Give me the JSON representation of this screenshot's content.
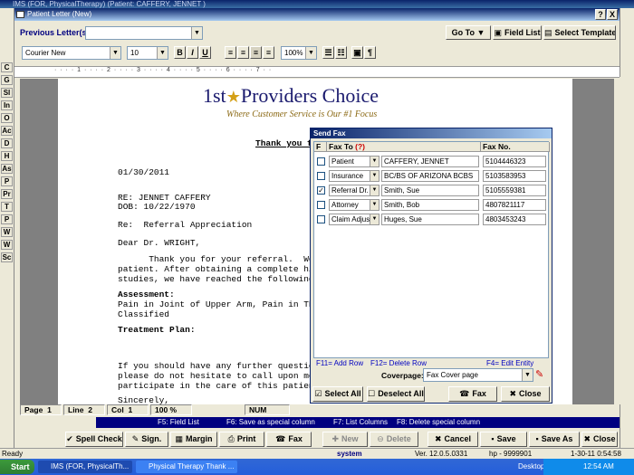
{
  "app": {
    "title": "IMS (FOR, PhysicalTherapy)    (Patient: CAFFERY, JENNET )"
  },
  "window": {
    "title": "Patient Letter (New)",
    "help_btn": "?",
    "close_btn": "X"
  },
  "toolbar": {
    "previous_letters_label": "Previous Letter(s):",
    "previous_letters_value": "",
    "goto": "Go To",
    "field_list": "Field List",
    "select_template": "Select Template"
  },
  "format": {
    "font": "Courier New",
    "size": "10",
    "bold": "B",
    "italic": "I",
    "underline": "U",
    "zoom": "100%",
    "pilcrow": "¶"
  },
  "ruler": {
    "text": "·  ·  ·  ·  1  ·  ·  ·  ·  2  ·  ·  ·  ·  3  ·  ·  ·  ·  4  ·  ·  ·  ·  5  ·  ·  ·  ·  6  ·  ·  ·  ·  7  ·  ·"
  },
  "letter": {
    "logo_pre": "1st",
    "logo_post": "Providers Choice",
    "tagline": "Where Customer Service is Our #1 Focus",
    "heading": "Thank you f",
    "date": "01/30/2011",
    "re_name": "RE: JENNET CAFFERY",
    "dob": "DOB: 10/22/1970",
    "re_subject": "Re:  Referral Appreciation",
    "salutation": "Dear Dr. WRIGHT,",
    "body1": "      Thank you for your referral.  We",
    "body2": "patient. After obtaining a complete his",
    "body3": "studies, we have reached the following",
    "assessment_label": "Assessment:",
    "assessment1": "Pain in Joint of Upper Arm, Pain in Tho",
    "assessment2": "Classified",
    "treatment_label": "Treatment Plan:",
    "closing1": "If you should have any further question",
    "closing2": "please do not hesitate to call upon me",
    "closing3": "participate in the care of this patient",
    "sincerely": "Sincerely,"
  },
  "status": {
    "page_label": "Page",
    "page": "1",
    "line_label": "Line",
    "line": "2",
    "col_label": "Col",
    "col": "1",
    "zoom": "100 %",
    "num": "NUM"
  },
  "hints": {
    "f5": "F5: Field List",
    "f6": "F6: Save as special column",
    "f7": "F7: List Columns",
    "f8": "F8: Delete special column"
  },
  "bottom_buttons": {
    "spell_check": "Spell Check",
    "sign": "Sign.",
    "margin": "Margin",
    "print": "Print",
    "fax": "Fax",
    "new": "New",
    "delete": "Delete",
    "cancel": "Cancel",
    "save": "Save",
    "save_as": "Save As",
    "close": "Close"
  },
  "fax_dialog": {
    "title": "Send Fax",
    "col_f": "F",
    "col_fax_to": "Fax To",
    "col_fax_to_mark": "(?)",
    "col_fax_no": "Fax No.",
    "rows": [
      {
        "checked": "",
        "type": "Patient",
        "name": "CAFFERY, JENNET",
        "fax": "5104446323"
      },
      {
        "checked": "",
        "type": "Insurance",
        "name": "BC/BS OF ARIZONA  BCBS",
        "fax": "5103583953"
      },
      {
        "checked": "✓",
        "type": "Referral Dr.",
        "name": "Smith, Sue",
        "fax": "5105559381"
      },
      {
        "checked": "",
        "type": "Attorney",
        "name": "Smith, Bob",
        "fax": "4807821117"
      },
      {
        "checked": "",
        "type": "Claim Adjuster",
        "name": "Huges, Sue",
        "fax": "4803453243"
      }
    ],
    "hint_f11": "F11= Add Row",
    "hint_f12": "F12= Delete Row",
    "hint_f4": "F4= Edit Entity",
    "coverpage_label": "Coverpage:",
    "coverpage_value": "Fax Cover page",
    "select_all": "Select All",
    "deselect_all": "Deselect All",
    "fax_btn": "Fax",
    "close_btn": "Close"
  },
  "app_status": {
    "ready": "Ready",
    "system": "system",
    "ver": "Ver. 12.0.5.0331",
    "hp": "hp - 9999901",
    "date": "1-30-11 0:54:58"
  },
  "taskbar": {
    "start": "Start",
    "task1": "IMS (FOR, PhysicalTh...",
    "task2": "Physical Therapy Thank ...",
    "desktop": "Desktop",
    "time": "12:54 AM"
  },
  "sidebar": {
    "items": [
      "C",
      "G",
      "Sl",
      "In",
      "O",
      "Ac",
      "D",
      "H",
      "As",
      "P",
      "Pr",
      "T",
      "P",
      "W",
      "W",
      "Sc"
    ]
  },
  "colors": {
    "title_blue": "#0a246a",
    "chrome": "#ece9d8",
    "hint_bar": "#000080"
  }
}
